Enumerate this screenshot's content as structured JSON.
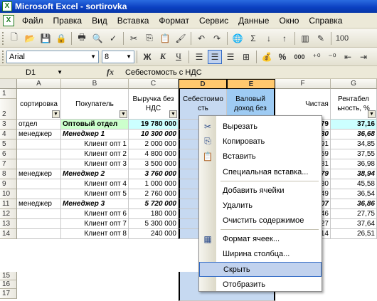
{
  "title": "Microsoft Excel - sortirovka",
  "menu": [
    "Файл",
    "Правка",
    "Вид",
    "Вставка",
    "Формат",
    "Сервис",
    "Данные",
    "Окно",
    "Справка"
  ],
  "toolbar": {
    "zoom_partial": "100"
  },
  "format_toolbar": {
    "font_name": "Arial",
    "font_size": "8",
    "bold": "Ж",
    "italic": "К",
    "underline": "Ч",
    "percent": "%",
    "thousands": "000"
  },
  "formula_bar": {
    "cell_ref": "D1",
    "fx": "fx",
    "formula": "Себестомость с НДС"
  },
  "columns": [
    "A",
    "B",
    "C",
    "D",
    "E",
    "F",
    "G"
  ],
  "rows": [
    "1",
    "2",
    "3",
    "4",
    "5",
    "6",
    "7",
    "8",
    "9",
    "10",
    "11",
    "12",
    "13",
    "14",
    "15",
    "16",
    "17"
  ],
  "headers": {
    "A": "сортировка",
    "B": "Покупатель",
    "C": "Выручка без НДС",
    "D": "Себестоимо сть",
    "E": "Валовый доход без",
    "F": "Чистая",
    "G": "Рентабел ьность, %"
  },
  "table_rows": [
    {
      "a": "отдел",
      "b": "Оптовый отдел",
      "c": "19 780 000",
      "d": "9",
      "f": "79",
      "g": "37,16"
    },
    {
      "a": "менеджер",
      "b": "Менеджер 1",
      "c": "10 300 000",
      "d": "5",
      "f": "30",
      "g": "36,68"
    },
    {
      "a": "",
      "b": "Клиент опт 1",
      "c": "2 000 000",
      "d": "1",
      "f": "91",
      "g": "34,85"
    },
    {
      "a": "",
      "b": "Клиент опт 2",
      "c": "4 800 000",
      "d": "2",
      "f": "59",
      "g": "37,55"
    },
    {
      "a": "",
      "b": "Клиент опт 3",
      "c": "3 500 000",
      "d": "1",
      "f": "81",
      "g": "36,98"
    },
    {
      "a": "менеджер",
      "b": "Менеджер 2",
      "c": "3 760 000",
      "d": "1",
      "f": "79",
      "g": "38,94"
    },
    {
      "a": "",
      "b": "Клиент опт 4",
      "c": "1 000 000",
      "d": "",
      "f": "30",
      "g": "45,58"
    },
    {
      "a": "",
      "b": "Клиент опт 5",
      "c": "2 760 000",
      "d": "1",
      "f": "49",
      "g": "36,54"
    },
    {
      "a": "менеджер",
      "b": "Менеджер 3",
      "c": "5 720 000",
      "d": "2",
      "f": "07",
      "g": "36,86"
    },
    {
      "a": "",
      "b": "Клиент опт 6",
      "c": "180 000",
      "d": "",
      "f": "46",
      "g": "27,75"
    },
    {
      "a": "",
      "b": "Клиент опт 7",
      "c": "5 300 000",
      "d": "2",
      "f": "27",
      "g": "37,64"
    },
    {
      "a": "",
      "b": "Клиент опт 8",
      "c": "240 000",
      "d": "",
      "f": "14",
      "g": "26,51"
    }
  ],
  "context_menu": [
    {
      "label": "Вырезать",
      "icon": "scissors-icon"
    },
    {
      "label": "Копировать",
      "icon": "copy-icon"
    },
    {
      "label": "Вставить",
      "icon": "paste-icon"
    },
    {
      "label": "Специальная вставка...",
      "icon": ""
    },
    {
      "label": "Добавить ячейки",
      "icon": ""
    },
    {
      "label": "Удалить",
      "icon": ""
    },
    {
      "label": "Очистить содержимое",
      "icon": ""
    },
    {
      "label": "Формат ячеек...",
      "icon": "format-cells-icon"
    },
    {
      "label": "Ширина столбца...",
      "icon": ""
    },
    {
      "label": "Скрыть",
      "icon": ""
    },
    {
      "label": "Отобразить",
      "icon": ""
    }
  ]
}
